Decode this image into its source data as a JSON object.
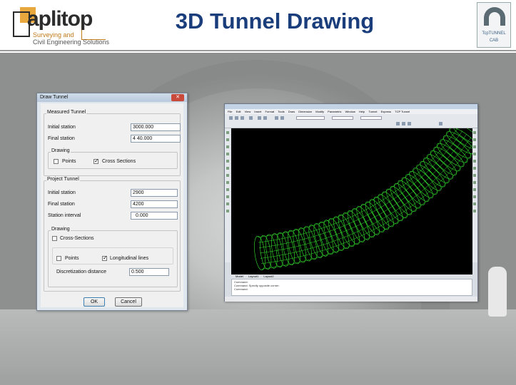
{
  "header": {
    "logo_brand": "aplitop",
    "logo_tagline_1": "Surveying and",
    "logo_tagline_2": "Civil Engineering Solutions",
    "slide_title": "3D Tunnel Drawing",
    "badge_line_1": "TcpTUNNEL",
    "badge_line_2": "CAB"
  },
  "dialog": {
    "title": "Draw Tunnel",
    "close_glyph": "✕",
    "measured_tunnel": {
      "group_title": "Measured Tunnel",
      "initial_station_label": "Initial station",
      "initial_station_value": "3000.000",
      "final_station_label": "Final station",
      "final_station_value": "4 40.000",
      "drawing_group_title": "Drawing",
      "points_label": "Points",
      "points_checked": false,
      "cross_sections_label": "Cross Sections",
      "cross_sections_checked": true
    },
    "project_tunnel": {
      "group_title": "Project Tunnel",
      "initial_station_label": "Initial station",
      "initial_station_value": "2900",
      "final_station_label": "Final station",
      "final_station_value": "4200",
      "station_interval_label": "Station interval",
      "station_interval_value": "0.000",
      "drawing_group_title": "Drawing",
      "cross_sections_label": "Cross-Sections",
      "cross_sections_checked": false,
      "points_label": "Points",
      "points_checked": false,
      "longitudinal_lines_label": "Longitudinal lines",
      "longitudinal_lines_checked": true,
      "discretization_label": "Discretization distance",
      "discretization_value": "0.500"
    },
    "ok_label": "OK",
    "cancel_label": "Cancel"
  },
  "cad": {
    "menu_items": [
      "File",
      "Edit",
      "View",
      "Insert",
      "Format",
      "Tools",
      "Draw",
      "Dimension",
      "Modify",
      "Parametric",
      "Window",
      "Help",
      "Tunnel",
      "Express",
      "TCP Tunnel"
    ],
    "tabs": [
      "Model",
      "Layout1",
      "Layout2"
    ],
    "command_lines": [
      "Command:",
      "Command: Specify opposite corner:",
      "Command:"
    ],
    "mesh_color": "#35e52f"
  }
}
